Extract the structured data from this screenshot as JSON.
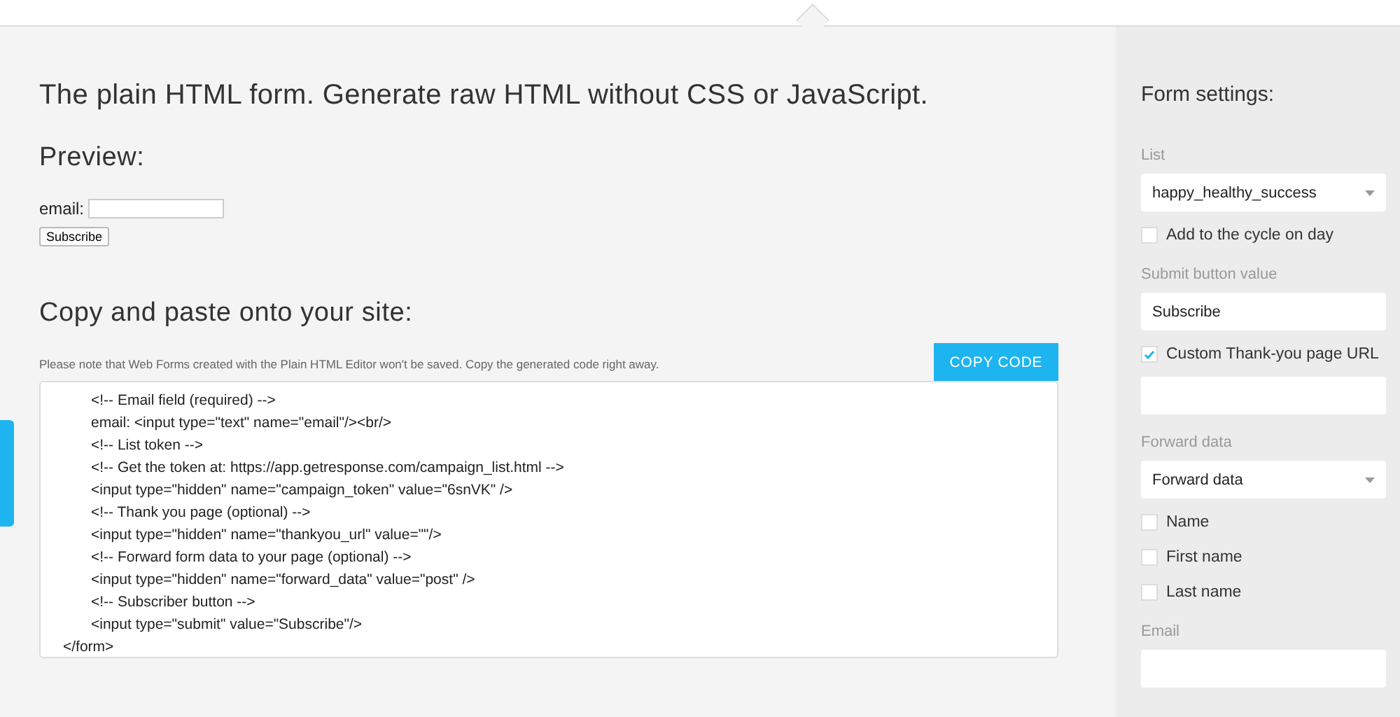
{
  "main": {
    "title": "The plain HTML form. Generate raw HTML without CSS or JavaScript.",
    "preview": {
      "heading": "Preview:",
      "field_label": "email:",
      "button": "Subscribe"
    },
    "copy": {
      "heading": "Copy and paste onto your site:",
      "note": "Please note that Web Forms created with the Plain HTML Editor won't be saved. Copy the generated code right away.",
      "button": "COPY CODE",
      "code_lines": [
        {
          "kind": "nested",
          "text": "<!-- Email field (required) -->"
        },
        {
          "kind": "nested",
          "text": "email: <input type=\"text\" name=\"email\"/><br/>"
        },
        {
          "kind": "nested",
          "text": "<!-- List token -->"
        },
        {
          "kind": "nested",
          "text": "<!-- Get the token at: https://app.getresponse.com/campaign_list.html -->"
        },
        {
          "kind": "nested",
          "text": "<input type=\"hidden\" name=\"campaign_token\" value=\"6snVK\" />"
        },
        {
          "kind": "nested",
          "text": "<!-- Thank you page (optional) -->"
        },
        {
          "kind": "nested",
          "text": "<input type=\"hidden\" name=\"thankyou_url\" value=\"\"/>"
        },
        {
          "kind": "nested",
          "text": "<!-- Forward form data to your page (optional) -->"
        },
        {
          "kind": "nested",
          "text": "<input type=\"hidden\" name=\"forward_data\" value=\"post\" />"
        },
        {
          "kind": "nested",
          "text": "<!-- Subscriber button -->"
        },
        {
          "kind": "nested",
          "text": "<input type=\"submit\" value=\"Subscribe\"/>"
        },
        {
          "kind": "root",
          "text": "</form>"
        }
      ]
    }
  },
  "sidebar": {
    "title": "Form settings:",
    "items": [
      {
        "kind": "select",
        "label": "List",
        "value": "happy_healthy_success"
      },
      {
        "kind": "checkbox",
        "label": "Add to the cycle on day",
        "checked": false
      },
      {
        "kind": "text",
        "label": "Submit button value",
        "value": "Subscribe"
      },
      {
        "kind": "checkbox",
        "label": "Custom Thank-you page URL",
        "checked": true
      },
      {
        "kind": "text"
      },
      {
        "kind": "select",
        "label": "Forward data",
        "value": "Forward data"
      },
      {
        "kind": "checkbox",
        "label": "Name",
        "checked": false
      },
      {
        "kind": "checkbox",
        "label": "First name",
        "checked": false
      },
      {
        "kind": "checkbox",
        "label": "Last name",
        "checked": false
      },
      {
        "kind": "text",
        "label": "Email"
      }
    ]
  }
}
